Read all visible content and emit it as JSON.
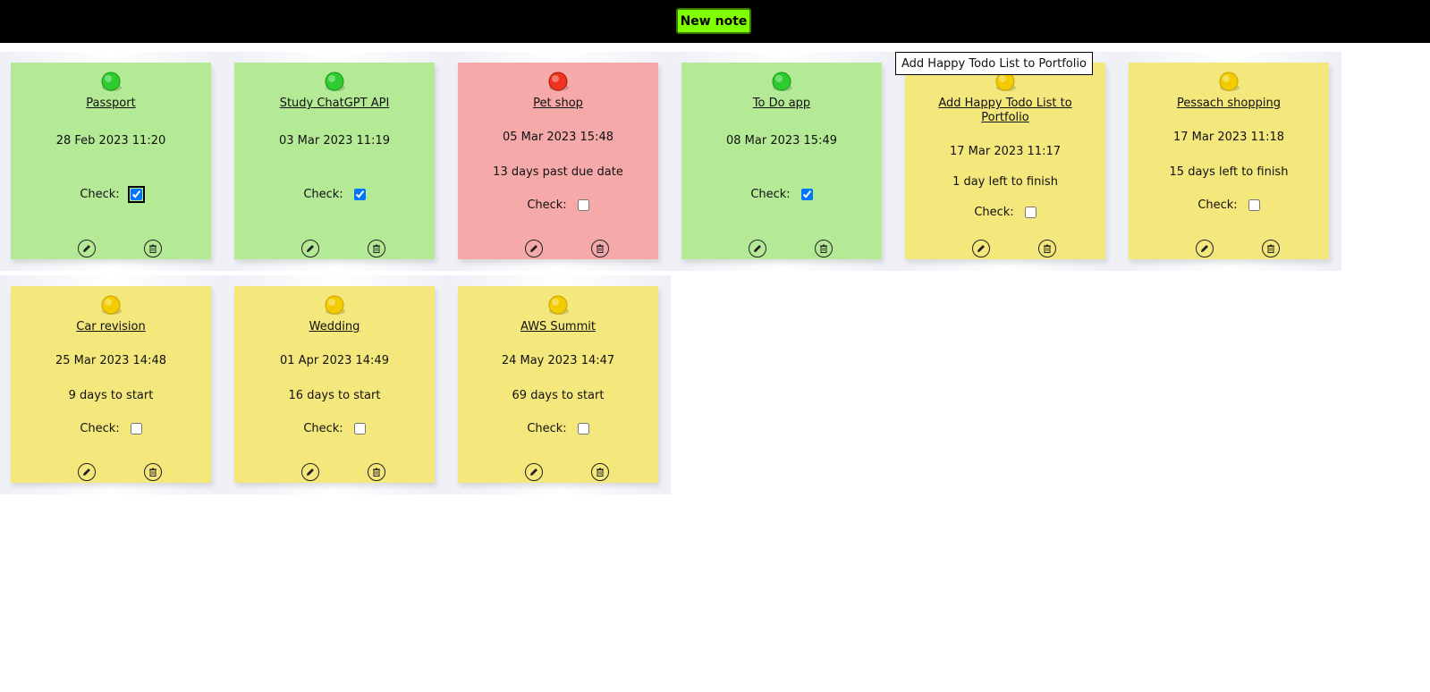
{
  "topbar": {
    "new_note_label": "New note"
  },
  "tooltip": "Add Happy Todo List to Portfolio",
  "check_label": "Check:",
  "colors": {
    "green": "#b4e996",
    "red": "#f5a9a9",
    "yellow": "#f4e77c",
    "button": "#7fff00"
  },
  "notes": [
    {
      "title": "Passport",
      "date": "28 Feb 2023 11:20",
      "status": "",
      "checked": true,
      "color": "green"
    },
    {
      "title": "Study ChatGPT API",
      "date": "03 Mar 2023 11:19",
      "status": "",
      "checked": true,
      "color": "green"
    },
    {
      "title": "Pet shop",
      "date": "05 Mar 2023 15:48",
      "status": "13 days past due date",
      "checked": false,
      "color": "red"
    },
    {
      "title": "To Do app",
      "date": "08 Mar 2023 15:49",
      "status": "",
      "checked": true,
      "color": "green"
    },
    {
      "title": "Add Happy Todo List to Portfolio",
      "date": "17 Mar 2023 11:17",
      "status": "1 day left to finish",
      "checked": false,
      "color": "yellow"
    },
    {
      "title": "Pessach shopping",
      "date": "17 Mar 2023 11:18",
      "status": "15 days left to finish",
      "checked": false,
      "color": "yellow"
    },
    {
      "title": "Car revision",
      "date": "25 Mar 2023 14:48",
      "status": "9 days to start",
      "checked": false,
      "color": "yellow"
    },
    {
      "title": "Wedding",
      "date": "01 Apr 2023 14:49",
      "status": "16 days to start",
      "checked": false,
      "color": "yellow"
    },
    {
      "title": "AWS Summit",
      "date": "24 May 2023 14:47",
      "status": "69 days to start",
      "checked": false,
      "color": "yellow"
    }
  ]
}
